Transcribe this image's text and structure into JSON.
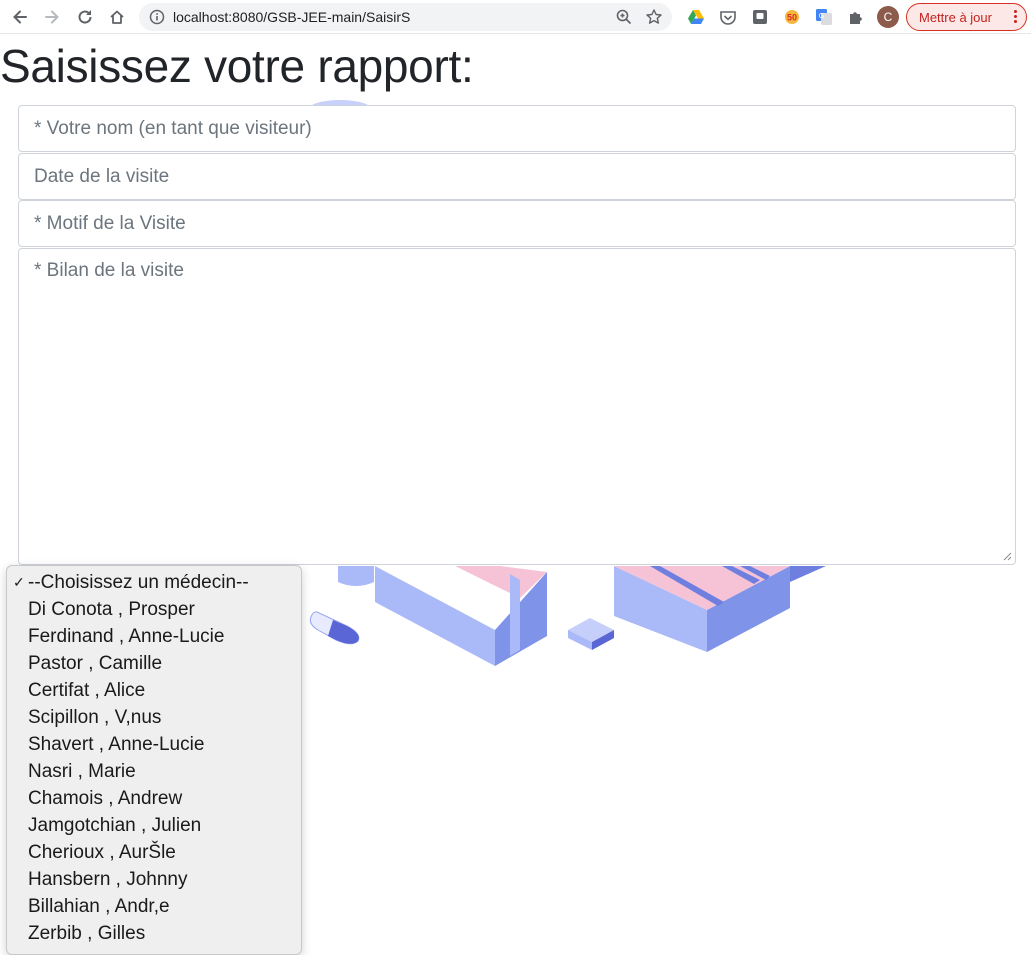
{
  "browser": {
    "url": "localhost:8080/GSB-JEE-main/SaisirS",
    "update_label": "Mettre à jour",
    "avatar_letter": "C",
    "extensions": [
      "google-drive-icon",
      "pocket-icon",
      "extension-square-icon",
      "badge-extension-icon",
      "google-translate-icon",
      "puzzle-icon"
    ]
  },
  "page": {
    "title": "Saisissez votre rapport:"
  },
  "form": {
    "nom_placeholder": "* Votre nom (en tant que visiteur)",
    "date_placeholder": "Date de la visite",
    "motif_placeholder": "* Motif de la Visite",
    "bilan_placeholder": "* Bilan de la visite"
  },
  "medecin_select": {
    "options": [
      "--Choisissez un médecin--",
      "Di Conota , Prosper",
      "Ferdinand , Anne-Lucie",
      "Pastor , Camille",
      "Certifat , Alice",
      "Scipillon , V,nus",
      "Shavert , Anne-Lucie",
      "Nasri , Marie",
      "Chamois , Andrew",
      "Jamgotchian , Julien",
      "Cherioux , AurŠle",
      "Hansbern , Johnny",
      "Billahian , Andr,e",
      "Zerbib , Gilles"
    ],
    "check_mark": "✓"
  },
  "colors": {
    "illustration_blue": "#aab9f7",
    "illustration_dark_blue": "#7f93e8",
    "illustration_pink": "#f6c3d6",
    "update_red": "#c5221f"
  }
}
